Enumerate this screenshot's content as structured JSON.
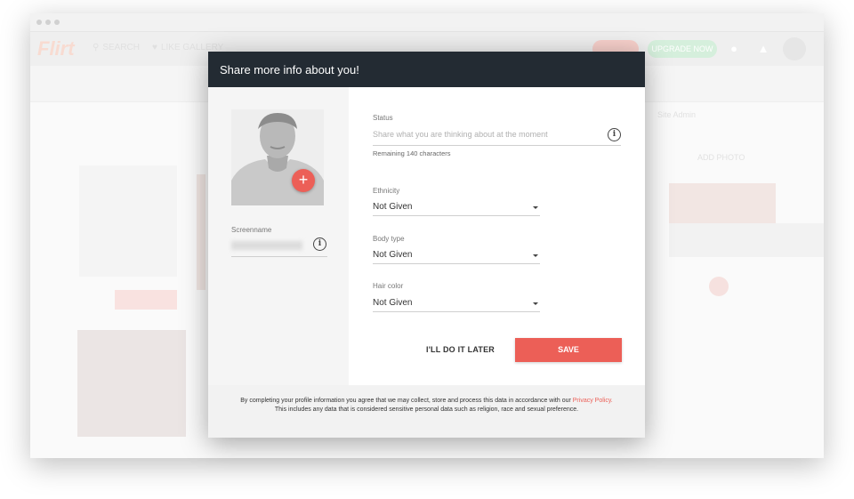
{
  "background": {
    "logo": "Flirt",
    "nav": [
      {
        "label": "SEARCH",
        "icon": "search-icon"
      },
      {
        "label": "LIKE GALLERY",
        "icon": "heart-icon"
      }
    ],
    "upgrade_label": "UPGRADE NOW",
    "side_user": "Site Admin",
    "add_photo_label": "ADD PHOTO"
  },
  "modal": {
    "title": "Share more info about you!",
    "screenname": {
      "label": "Screenname",
      "value": ""
    },
    "status": {
      "label": "Status",
      "placeholder": "Share what you are thinking about at the moment",
      "remaining": "Remaining 140 characters"
    },
    "fields": [
      {
        "label": "Ethnicity",
        "value": "Not Given"
      },
      {
        "label": "Body type",
        "value": "Not Given"
      },
      {
        "label": "Hair color",
        "value": "Not Given"
      }
    ],
    "later_label": "I'LL DO IT LATER",
    "save_label": "SAVE",
    "footer": {
      "text_before": "By completing your profile information you agree that we may collect, store and process this data in accordance with our",
      "link": "Privacy Policy.",
      "text_after": "This includes any data that is considered sensitive personal data such as religion, race and sexual preference."
    }
  },
  "colors": {
    "accent": "#ec5f57",
    "header": "#232b33"
  }
}
